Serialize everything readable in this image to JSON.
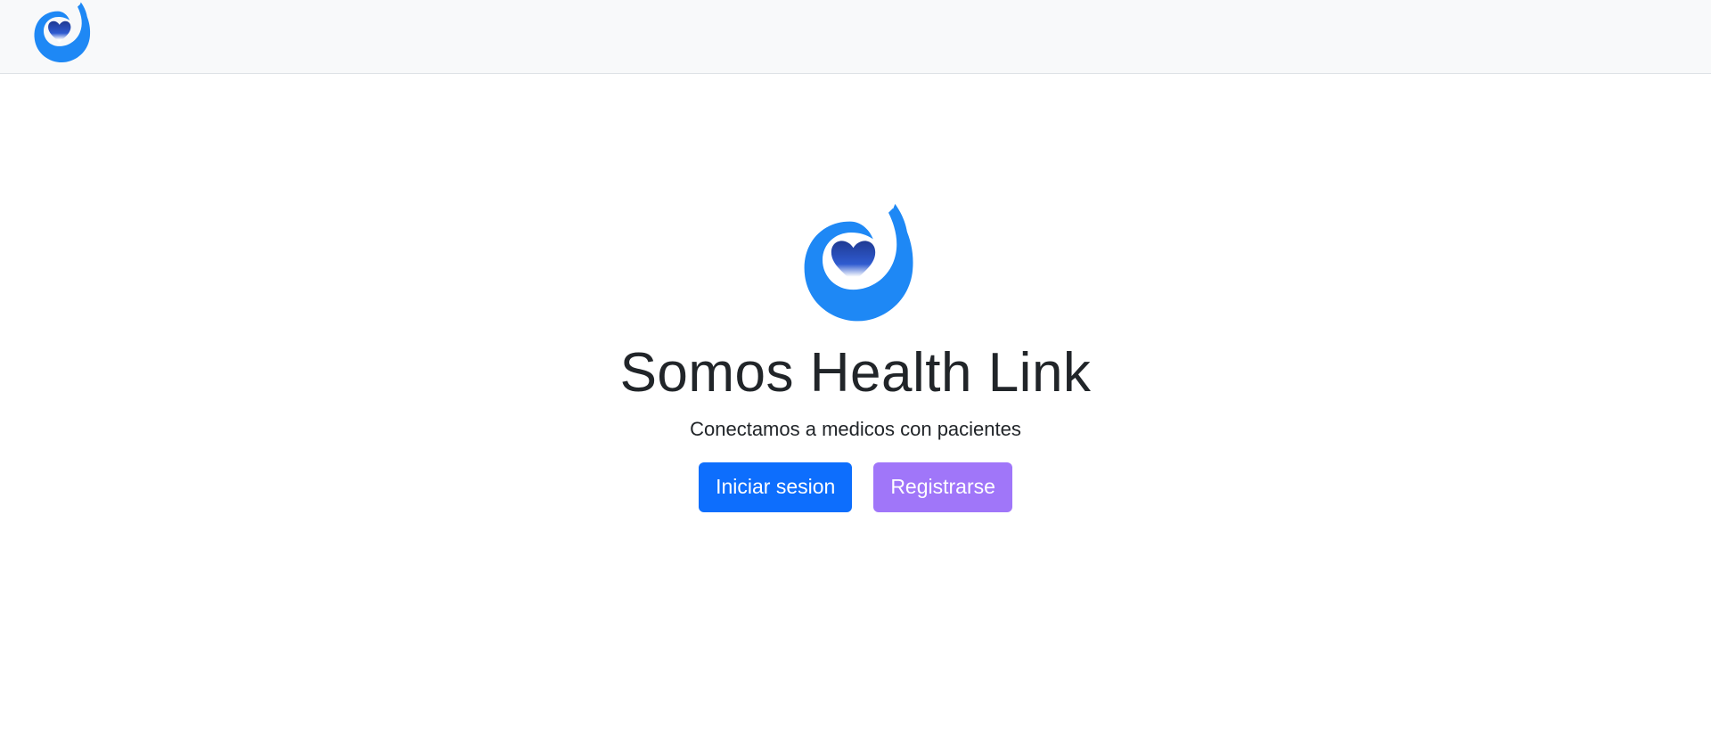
{
  "navbar": {
    "logo_icon": "health-link-logo-icon"
  },
  "hero": {
    "logo_icon": "health-link-logo-icon",
    "title": "Somos Health Link",
    "subtitle": "Conectamos a medicos con pacientes",
    "login_button": "Iniciar sesion",
    "register_button": "Registrarse"
  },
  "colors": {
    "primary": "#0d6efd",
    "secondary_purple": "#a076f9",
    "logo_blue": "#1e88f5",
    "heart_navy": "#1f3a93",
    "navbar_bg": "#f8f9fa",
    "text": "#212529"
  }
}
